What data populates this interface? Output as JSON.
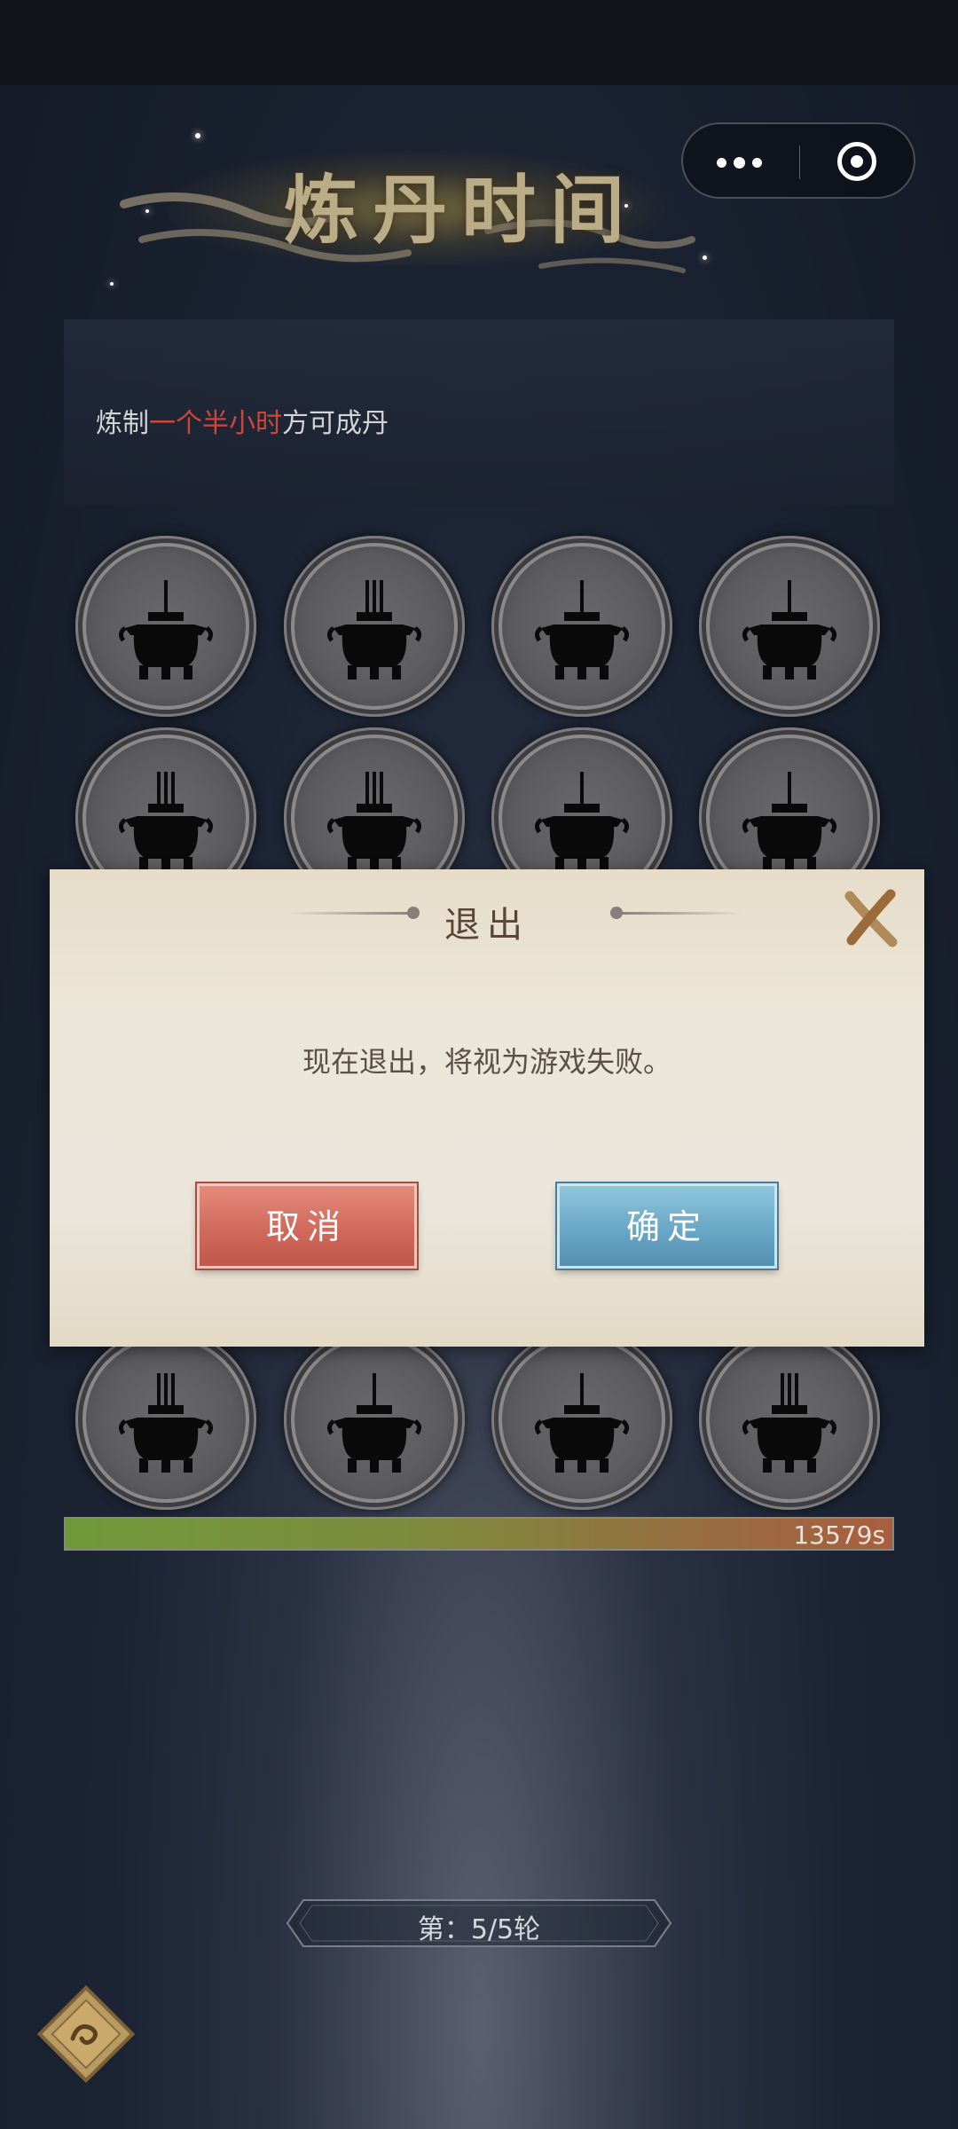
{
  "header": {
    "title": "炼丹时间"
  },
  "capsule": {
    "more_icon": "more-dots-icon",
    "close_icon": "target-circle-icon"
  },
  "info": {
    "prefix": "炼制",
    "highlight": "一个半小时",
    "suffix": "方可成丹",
    "highlight_color": "#d0463b"
  },
  "cauldron_grid": {
    "rows": 4,
    "columns": 4,
    "icon": "cauldron-icon"
  },
  "dialog": {
    "title": "退出",
    "message": "现在退出，将视为游戏失败。",
    "cancel_label": "取消",
    "confirm_label": "确定",
    "close_icon": "close-x-icon"
  },
  "progress": {
    "value_text": "13579s",
    "fraction": 1.0
  },
  "round": {
    "label": "第：5/5轮"
  },
  "menu": {
    "icon": "diamond-menu-icon"
  }
}
